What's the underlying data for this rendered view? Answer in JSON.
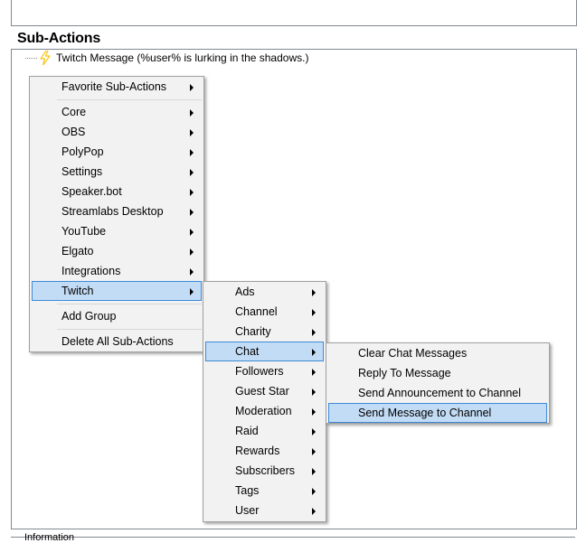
{
  "section": {
    "title": "Sub-Actions"
  },
  "tree": {
    "node_label": "Twitch Message (%user% is lurking in the shadows.)"
  },
  "footer": {
    "info_label": "Information"
  },
  "main_menu": {
    "items": [
      {
        "label": "Favorite Sub-Actions",
        "submenu": true
      },
      {
        "label": "Core",
        "submenu": true
      },
      {
        "label": "OBS",
        "submenu": true
      },
      {
        "label": "PolyPop",
        "submenu": true
      },
      {
        "label": "Settings",
        "submenu": true
      },
      {
        "label": "Speaker.bot",
        "submenu": true
      },
      {
        "label": "Streamlabs Desktop",
        "submenu": true
      },
      {
        "label": "YouTube",
        "submenu": true
      },
      {
        "label": "Elgato",
        "submenu": true
      },
      {
        "label": "Integrations",
        "submenu": true
      },
      {
        "label": "Twitch",
        "submenu": true,
        "highlighted": true
      },
      {
        "label": "Add Group",
        "submenu": false
      },
      {
        "label": "Delete All Sub-Actions",
        "submenu": false
      }
    ]
  },
  "twitch_menu": {
    "items": [
      {
        "label": "Ads"
      },
      {
        "label": "Channel"
      },
      {
        "label": "Charity"
      },
      {
        "label": "Chat",
        "highlighted": true
      },
      {
        "label": "Followers"
      },
      {
        "label": "Guest Star"
      },
      {
        "label": "Moderation"
      },
      {
        "label": "Raid"
      },
      {
        "label": "Rewards"
      },
      {
        "label": "Subscribers"
      },
      {
        "label": "Tags"
      },
      {
        "label": "User"
      }
    ]
  },
  "chat_menu": {
    "items": [
      {
        "label": "Clear Chat Messages"
      },
      {
        "label": "Reply To Message"
      },
      {
        "label": "Send Announcement to Channel"
      },
      {
        "label": "Send Message to Channel",
        "highlighted": true
      }
    ]
  },
  "colors": {
    "highlight_bg": "#c3dcf5",
    "highlight_border": "#3c8ad8",
    "menu_bg": "#f2f2f2",
    "bolt": "#f5c518"
  }
}
